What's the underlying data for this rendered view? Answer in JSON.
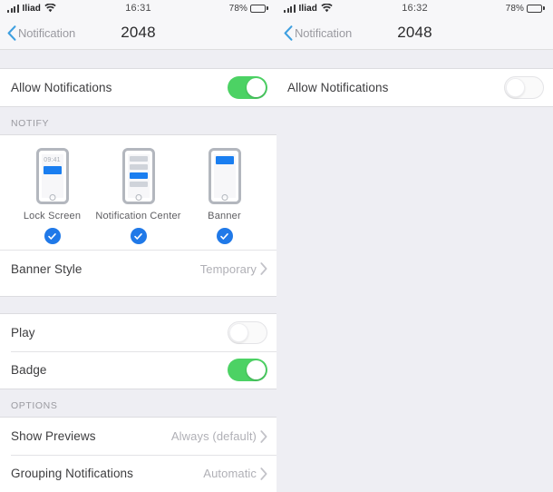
{
  "colors": {
    "toggle_on": "#4cd264",
    "check_blue": "#2079e8",
    "notification_blue": "#1a7ef0",
    "background": "#eeeef3",
    "nav_background": "#f7f7f9"
  },
  "screens": [
    {
      "id": "notifications-enabled",
      "status_bar": {
        "carrier": "Iliad",
        "signal_icon": "cellular-signal-icon",
        "wifi_icon": "wifi-icon",
        "time": "16:31",
        "battery_percent": "78%",
        "battery_icon": "battery-icon"
      },
      "nav": {
        "back_icon": "chevron-left-icon",
        "back_label": "Notification",
        "title": "2048"
      },
      "allow": {
        "label": "Allow Notifications",
        "state": "on"
      },
      "notify_section": {
        "header": "NOTIFY",
        "alert_styles": [
          {
            "label": "Lock Screen",
            "icon": "lock-screen-phone-icon",
            "lock_time": "09:41",
            "selected": true,
            "check_icon": "check-circle-icon"
          },
          {
            "label": "Notification Center",
            "icon": "notification-center-phone-icon",
            "selected": true,
            "check_icon": "check-circle-icon"
          },
          {
            "label": "Banner",
            "icon": "banner-phone-icon",
            "selected": true,
            "check_icon": "check-circle-icon"
          }
        ],
        "banner_style": {
          "label": "Banner Style",
          "value": "Temporary",
          "chevron_icon": "chevron-right-icon"
        }
      },
      "sounds_badges": [
        {
          "label": "Play",
          "state": "off"
        },
        {
          "label": "Badge",
          "state": "on"
        }
      ],
      "options_section": {
        "header": "OPTIONS",
        "rows": [
          {
            "label": "Show Previews",
            "value": "Always (default)",
            "chevron_icon": "chevron-right-icon"
          },
          {
            "label": "Grouping Notifications",
            "value": "Automatic",
            "chevron_icon": "chevron-right-icon"
          }
        ]
      }
    },
    {
      "id": "notifications-disabled",
      "status_bar": {
        "carrier": "Iliad",
        "signal_icon": "cellular-signal-icon",
        "wifi_icon": "wifi-icon",
        "time": "16:32",
        "battery_percent": "78%",
        "battery_icon": "battery-icon"
      },
      "nav": {
        "back_icon": "chevron-left-icon",
        "back_label": "Notification",
        "title": "2048"
      },
      "allow": {
        "label": "Allow Notifications",
        "state": "off"
      }
    }
  ]
}
